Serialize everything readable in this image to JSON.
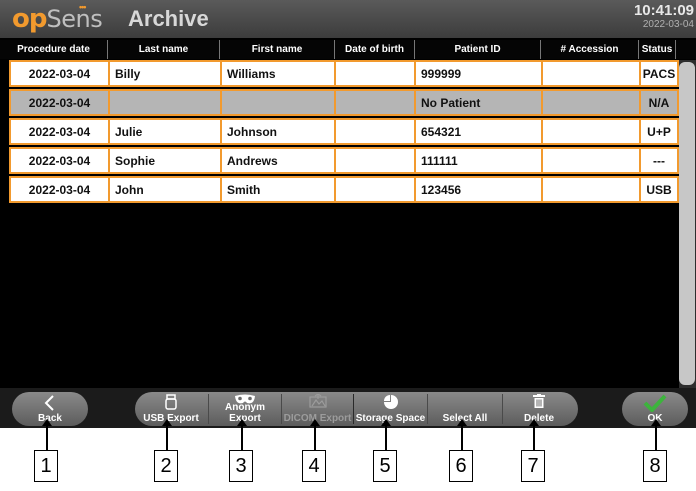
{
  "header": {
    "logo_op": "op",
    "logo_sens": "Sens",
    "logo_dots": "•••",
    "title": "Archive",
    "time": "10:41:09",
    "date": "2022-03-04"
  },
  "columns": [
    "Procedure date",
    "Last name",
    "First name",
    "Date of birth",
    "Patient ID",
    "# Accession",
    "Status"
  ],
  "rows": [
    {
      "date": "2022-03-04",
      "last": "Billy",
      "first": "Williams",
      "dob": "",
      "pid": "999999",
      "acc": "",
      "status": "PACS"
    },
    {
      "date": "2022-03-04",
      "last": "",
      "first": "",
      "dob": "",
      "pid": "No Patient",
      "acc": "",
      "status": "N/A"
    },
    {
      "date": "2022-03-04",
      "last": "Julie",
      "first": "Johnson",
      "dob": "",
      "pid": "654321",
      "acc": "",
      "status": "U+P"
    },
    {
      "date": "2022-03-04",
      "last": "Sophie",
      "first": "Andrews",
      "dob": "",
      "pid": "111111",
      "acc": "",
      "status": "---"
    },
    {
      "date": "2022-03-04",
      "last": "John",
      "first": "Smith",
      "dob": "",
      "pid": "123456",
      "acc": "",
      "status": "USB"
    }
  ],
  "toolbar": {
    "back": "Back",
    "usb_export": "USB Export",
    "anonym_export": "Anonym Export",
    "dicom_export": "DICOM Export",
    "storage_space": "Storage Space",
    "select_all": "Select All",
    "delete": "Delete",
    "ok": "OK"
  },
  "callouts": [
    "1",
    "2",
    "3",
    "4",
    "5",
    "6",
    "7",
    "8"
  ],
  "colors": {
    "accent": "#f29a2e",
    "selected_row": "#b5b5b5",
    "ok_check": "#3cb43c"
  }
}
